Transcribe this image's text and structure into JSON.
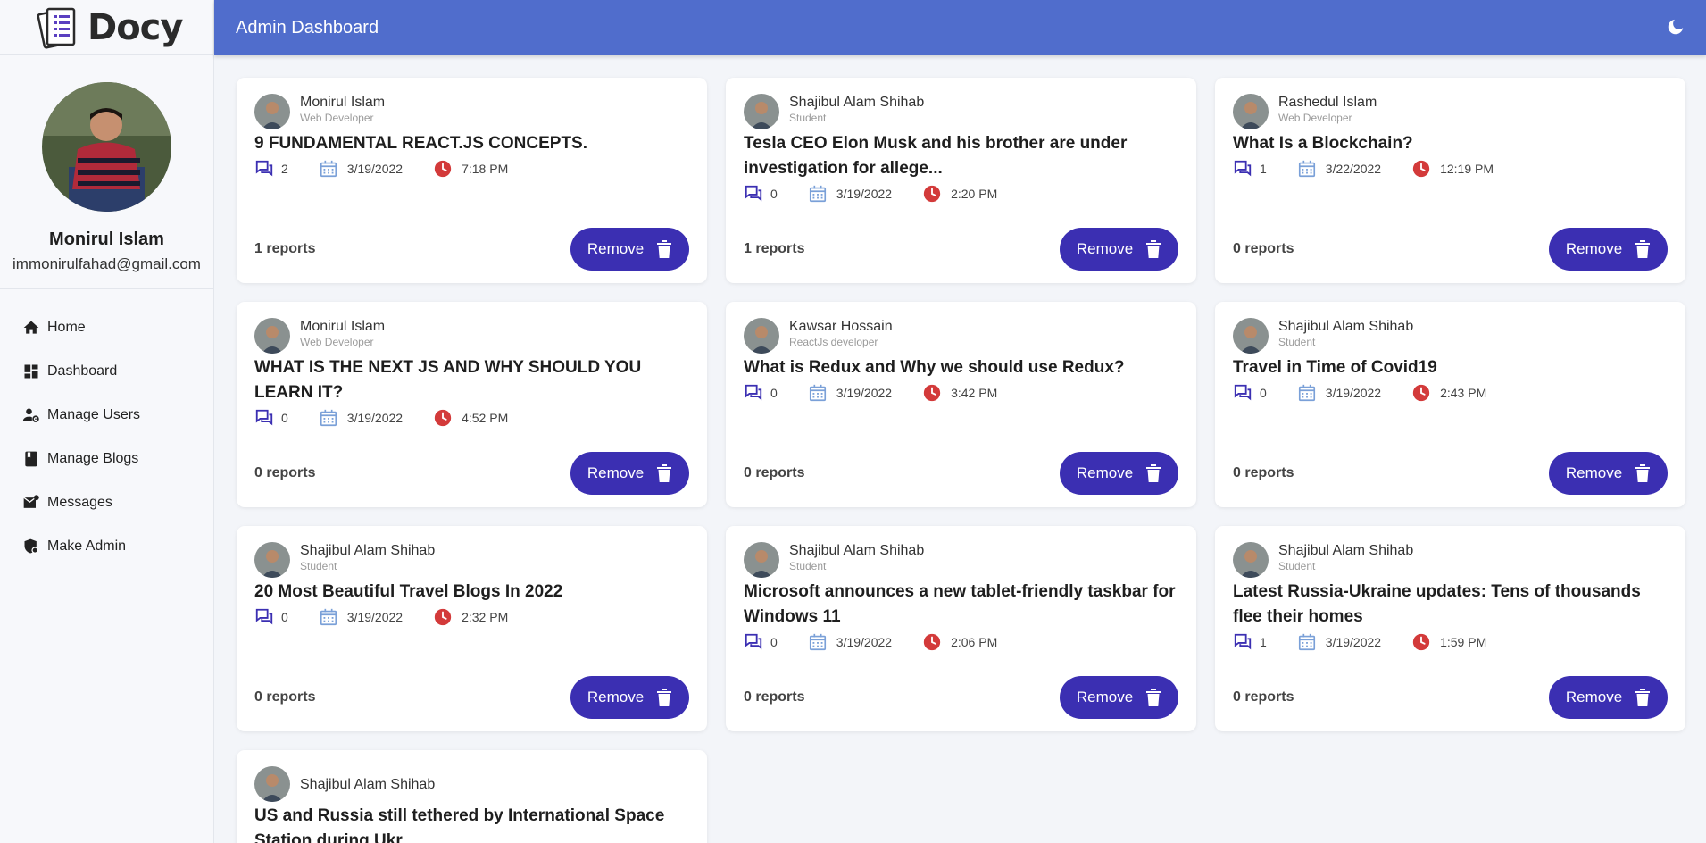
{
  "brand": {
    "name": "Docy"
  },
  "header": {
    "title": "Admin Dashboard",
    "theme_icon": "moon-icon"
  },
  "profile": {
    "name": "Monirul Islam",
    "email": "immonirulfahad@gmail.com"
  },
  "nav": [
    {
      "label": "Home",
      "icon": "home-icon"
    },
    {
      "label": "Dashboard",
      "icon": "dashboard-icon"
    },
    {
      "label": "Manage Users",
      "icon": "users-gear-icon"
    },
    {
      "label": "Manage Blogs",
      "icon": "book-icon"
    },
    {
      "label": "Messages",
      "icon": "mail-icon"
    },
    {
      "label": "Make Admin",
      "icon": "admin-shield-icon"
    }
  ],
  "remove_label": "Remove",
  "blogs": [
    {
      "author": "Monirul Islam",
      "role": "Web Developer",
      "title": "9 FUNDAMENTAL REACT.JS CONCEPTS.",
      "comments": "2",
      "date": "3/19/2022",
      "time": "7:18 PM",
      "reports": "1 reports"
    },
    {
      "author": "Shajibul Alam Shihab",
      "role": "Student",
      "title": "Tesla CEO Elon Musk and his brother are under investigation for allege...",
      "comments": "0",
      "date": "3/19/2022",
      "time": "2:20 PM",
      "reports": "1 reports"
    },
    {
      "author": "Rashedul Islam",
      "role": "Web Developer",
      "title": "What Is a Blockchain?",
      "comments": "1",
      "date": "3/22/2022",
      "time": "12:19 PM",
      "reports": "0 reports"
    },
    {
      "author": "Monirul Islam",
      "role": "Web Developer",
      "title": "WHAT IS THE NEXT JS AND WHY SHOULD YOU LEARN IT?",
      "comments": "0",
      "date": "3/19/2022",
      "time": "4:52 PM",
      "reports": "0 reports"
    },
    {
      "author": "Kawsar Hossain",
      "role": "ReactJs developer",
      "title": "What is Redux and Why we should use Redux?",
      "comments": "0",
      "date": "3/19/2022",
      "time": "3:42 PM",
      "reports": "0 reports"
    },
    {
      "author": "Shajibul Alam Shihab",
      "role": "Student",
      "title": "Travel in Time of Covid19",
      "comments": "0",
      "date": "3/19/2022",
      "time": "2:43 PM",
      "reports": "0 reports"
    },
    {
      "author": "Shajibul Alam Shihab",
      "role": "Student",
      "title": "20 Most Beautiful Travel Blogs In 2022",
      "comments": "0",
      "date": "3/19/2022",
      "time": "2:32 PM",
      "reports": "0 reports"
    },
    {
      "author": "Shajibul Alam Shihab",
      "role": "Student",
      "title": "Microsoft announces a new tablet-friendly taskbar for Windows 11",
      "comments": "0",
      "date": "3/19/2022",
      "time": "2:06 PM",
      "reports": "0 reports"
    },
    {
      "author": "Shajibul Alam Shihab",
      "role": "Student",
      "title": "Latest Russia-Ukraine updates: Tens of thousands flee their homes",
      "comments": "1",
      "date": "3/19/2022",
      "time": "1:59 PM",
      "reports": "0 reports"
    },
    {
      "author": "Shajibul Alam Shihab",
      "role": "",
      "title": "US and Russia still tethered by International Space Station during Ukr...",
      "comments": "",
      "date": "",
      "time": "",
      "reports": ""
    }
  ]
}
